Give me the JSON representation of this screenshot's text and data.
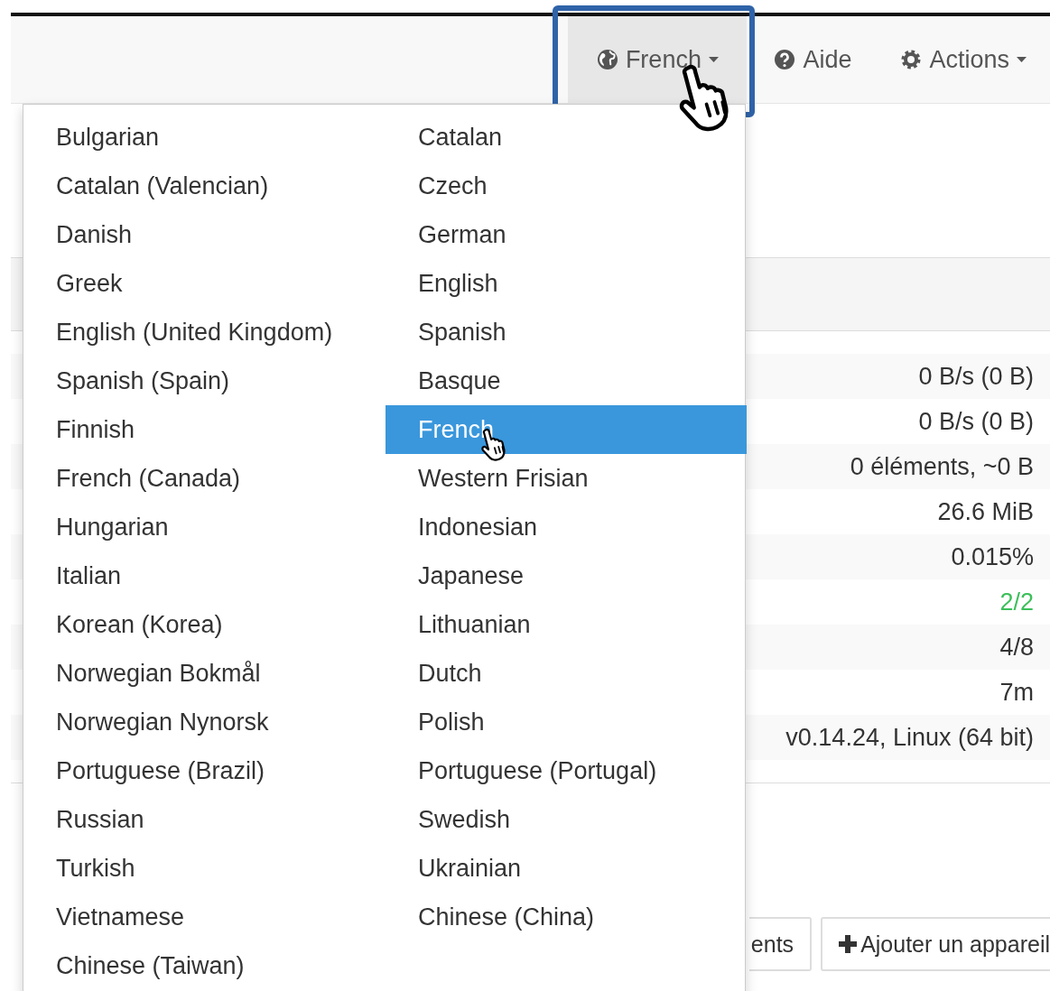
{
  "navbar": {
    "items": [
      {
        "kind": "dropdown",
        "label": "French",
        "expanded": true
      },
      {
        "kind": "link",
        "label": "Aide"
      },
      {
        "kind": "dropdown",
        "label": "Actions",
        "expanded": false
      }
    ]
  },
  "language_menu": {
    "items": [
      {
        "label": "Bulgarian",
        "selected": false
      },
      {
        "label": "Catalan",
        "selected": false
      },
      {
        "label": "Catalan (Valencian)",
        "selected": false
      },
      {
        "label": "Czech",
        "selected": false
      },
      {
        "label": "Danish",
        "selected": false
      },
      {
        "label": "German",
        "selected": false
      },
      {
        "label": "Greek",
        "selected": false
      },
      {
        "label": "English",
        "selected": false
      },
      {
        "label": "English (United Kingdom)",
        "selected": false
      },
      {
        "label": "Spanish",
        "selected": false
      },
      {
        "label": "Spanish (Spain)",
        "selected": false
      },
      {
        "label": "Basque",
        "selected": false
      },
      {
        "label": "Finnish",
        "selected": false
      },
      {
        "label": "French",
        "selected": true
      },
      {
        "label": "French (Canada)",
        "selected": false
      },
      {
        "label": "Western Frisian",
        "selected": false
      },
      {
        "label": "Hungarian",
        "selected": false
      },
      {
        "label": "Indonesian",
        "selected": false
      },
      {
        "label": "Italian",
        "selected": false
      },
      {
        "label": "Japanese",
        "selected": false
      },
      {
        "label": "Korean (Korea)",
        "selected": false
      },
      {
        "label": "Lithuanian",
        "selected": false
      },
      {
        "label": "Norwegian Bokmål",
        "selected": false
      },
      {
        "label": "Dutch",
        "selected": false
      },
      {
        "label": "Norwegian Nynorsk",
        "selected": false
      },
      {
        "label": "Polish",
        "selected": false
      },
      {
        "label": "Portuguese (Brazil)",
        "selected": false
      },
      {
        "label": "Portuguese (Portugal)",
        "selected": false
      },
      {
        "label": "Russian",
        "selected": false
      },
      {
        "label": "Swedish",
        "selected": false
      },
      {
        "label": "Turkish",
        "selected": false
      },
      {
        "label": "Ukrainian",
        "selected": false
      },
      {
        "label": "Vietnamese",
        "selected": false
      },
      {
        "label": "Chinese (China)",
        "selected": false
      },
      {
        "label": "Chinese (Taiwan)",
        "selected": false
      }
    ]
  },
  "stats_panel": {
    "values": [
      {
        "value": "0 B/s (0 B)",
        "color": "#333333"
      },
      {
        "value": "0 B/s (0 B)",
        "color": "#333333"
      },
      {
        "value": "0 éléments, ~0 B",
        "color": "#333333"
      },
      {
        "value": "26.6 MiB",
        "color": "#333333"
      },
      {
        "value": "0.015%",
        "color": "#333333"
      },
      {
        "value": "2/2",
        "color": "#3cbf5a"
      },
      {
        "value": "4/8",
        "color": "#333333"
      },
      {
        "value": "7m",
        "color": "#333333"
      },
      {
        "value": "v0.14.24, Linux (64 bit)",
        "color": "#333333"
      }
    ]
  },
  "buttons": [
    {
      "kind": "plain",
      "label": "ents"
    },
    {
      "kind": "add",
      "label": "Ajouter un appareil"
    }
  ]
}
